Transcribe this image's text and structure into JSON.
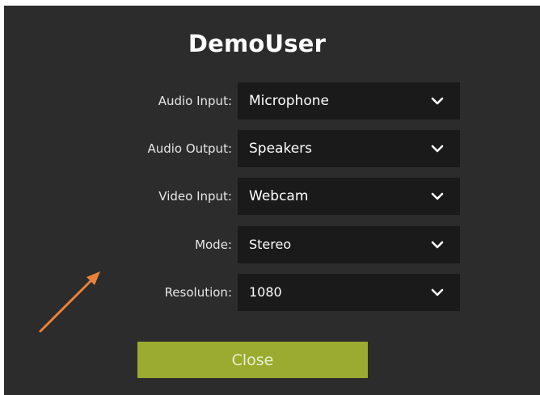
{
  "dialog": {
    "title": "DemoUser",
    "close_label": "Close"
  },
  "fields": [
    {
      "label": "Audio Input:",
      "value": "Microphone"
    },
    {
      "label": "Audio Output:",
      "value": "Speakers"
    },
    {
      "label": "Video Input:",
      "value": "Webcam"
    },
    {
      "label": "Mode:",
      "value": "Stereo"
    },
    {
      "label": "Resolution:",
      "value": "1080"
    }
  ],
  "icons": {
    "dropdown": "chevron-down-icon",
    "annotation": "arrow-annotation"
  },
  "colors": {
    "dialog_background": "#2c2c2c",
    "select_background": "#1a1a1a",
    "close_button": "#9aab2f",
    "annotation_arrow": "#e8823a"
  }
}
